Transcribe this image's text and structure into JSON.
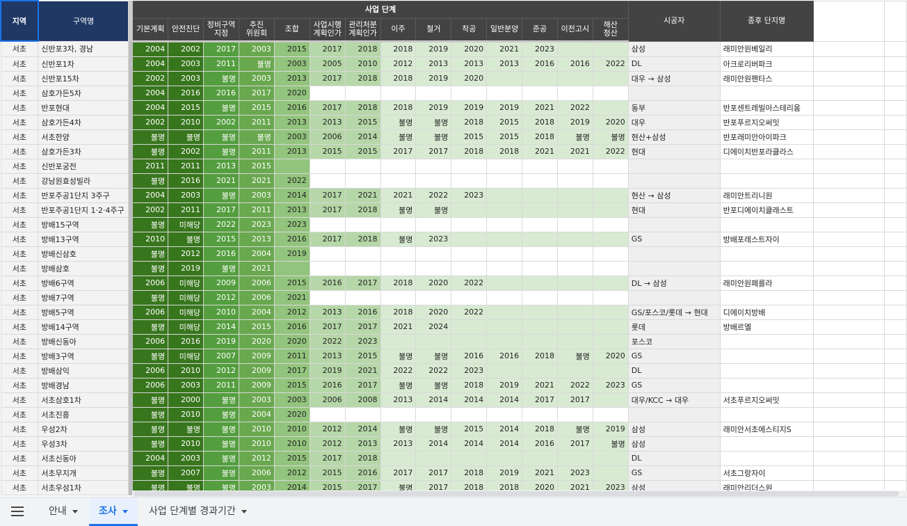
{
  "header": {
    "region": "지역",
    "name": "구역명",
    "group": "사업 단계",
    "stages": [
      "기본계획",
      "안전진단",
      "정비구역\n지정",
      "추진\n위원회",
      "조합",
      "사업시행\n계획인가",
      "관리처분\n계획인가",
      "이주",
      "철거",
      "착공",
      "일반분양",
      "준공",
      "이전고시",
      "해산\n청산"
    ],
    "contractor": "시공자",
    "final_name": "종후 단지명"
  },
  "rows": [
    {
      "region": "서초",
      "name": "신반포3차, 경남",
      "stages": [
        "2004",
        "2002",
        "2017",
        "2003",
        "2015",
        "2017",
        "2018",
        "2018",
        "2019",
        "2020",
        "2021",
        "2023",
        "",
        ""
      ],
      "contractor": "삼성",
      "final": "래미안원베일리"
    },
    {
      "region": "서초",
      "name": "신반포1차",
      "stages": [
        "2004",
        "2003",
        "2011",
        "불명",
        "2003",
        "2005",
        "2010",
        "2012",
        "2013",
        "2013",
        "2013",
        "2016",
        "2016",
        "2022"
      ],
      "contractor": "DL",
      "final": "아크로리버파크"
    },
    {
      "region": "서초",
      "name": "신반포15차",
      "stages": [
        "2002",
        "2003",
        "불명",
        "2003",
        "2013",
        "2017",
        "2018",
        "2018",
        "2019",
        "2020",
        "",
        "",
        "",
        ""
      ],
      "contractor": "대우 → 삼성",
      "final": "래미안원펜타스"
    },
    {
      "region": "서초",
      "name": "삼호가든5차",
      "stages": [
        "2004",
        "2016",
        "2016",
        "2017",
        "2020",
        "",
        "",
        "",
        "",
        "",
        "",
        "",
        "",
        ""
      ],
      "contractor": "",
      "final": ""
    },
    {
      "region": "서초",
      "name": "반포현대",
      "stages": [
        "2004",
        "2015",
        "불명",
        "2015",
        "2016",
        "2017",
        "2018",
        "2018",
        "2019",
        "2019",
        "2019",
        "2021",
        "2022",
        ""
      ],
      "contractor": "동부",
      "final": "반포센트레빌아스테리움"
    },
    {
      "region": "서초",
      "name": "삼호가든4차",
      "stages": [
        "2002",
        "2010",
        "2002",
        "2011",
        "2013",
        "2013",
        "2015",
        "불명",
        "불명",
        "2018",
        "2015",
        "2018",
        "2019",
        "2020"
      ],
      "contractor": "대우",
      "final": "반포푸르지오써밋"
    },
    {
      "region": "서초",
      "name": "서초한양",
      "stages": [
        "불명",
        "불명",
        "불명",
        "불명",
        "2003",
        "2006",
        "2014",
        "불명",
        "불명",
        "2015",
        "2015",
        "2018",
        "불명",
        "불명"
      ],
      "contractor": "현산+삼성",
      "final": "반포래미안아이파크"
    },
    {
      "region": "서초",
      "name": "삼호가든3차",
      "stages": [
        "불명",
        "2002",
        "불명",
        "2011",
        "2013",
        "2015",
        "2015",
        "2017",
        "2017",
        "2018",
        "2018",
        "2021",
        "2021",
        "2022"
      ],
      "contractor": "현대",
      "final": "디에이치반포라클라스"
    },
    {
      "region": "서초",
      "name": "신반포궁전",
      "stages": [
        "2011",
        "2011",
        "2013",
        "2015",
        "",
        "",
        "",
        "",
        "",
        "",
        "",
        "",
        "",
        ""
      ],
      "contractor": "",
      "final": ""
    },
    {
      "region": "서초",
      "name": "강남원효성빌라",
      "stages": [
        "불명",
        "2016",
        "2021",
        "2021",
        "2022",
        "",
        "",
        "",
        "",
        "",
        "",
        "",
        "",
        ""
      ],
      "contractor": "",
      "final": ""
    },
    {
      "region": "서초",
      "name": "반포주공1단지 3주구",
      "stages": [
        "2004",
        "2003",
        "불명",
        "2003",
        "2014",
        "2017",
        "2021",
        "2021",
        "2022",
        "2023",
        "",
        "",
        "",
        ""
      ],
      "contractor": "현산 → 삼성",
      "final": "래미안트리니원"
    },
    {
      "region": "서초",
      "name": "반포주공1단지 1·2·4주구",
      "stages": [
        "2002",
        "2011",
        "2017",
        "2011",
        "2013",
        "2017",
        "2018",
        "불명",
        "불명",
        "",
        "",
        "",
        "",
        ""
      ],
      "contractor": "현대",
      "final": "반포디에이치클래스트"
    },
    {
      "region": "서초",
      "name": "방배15구역",
      "stages": [
        "불명",
        "미해당",
        "2022",
        "2023",
        "2023",
        "",
        "",
        "",
        "",
        "",
        "",
        "",
        "",
        ""
      ],
      "contractor": "",
      "final": ""
    },
    {
      "region": "서초",
      "name": "방배13구역",
      "stages": [
        "2010",
        "불명",
        "2015",
        "2013",
        "2016",
        "2017",
        "2018",
        "불명",
        "2023",
        "",
        "",
        "",
        "",
        ""
      ],
      "contractor": "GS",
      "final": "방배포레스트자이"
    },
    {
      "region": "서초",
      "name": "방배신삼호",
      "stages": [
        "불명",
        "2012",
        "2016",
        "2004",
        "2019",
        "",
        "",
        "",
        "",
        "",
        "",
        "",
        "",
        ""
      ],
      "contractor": "",
      "final": ""
    },
    {
      "region": "서초",
      "name": "방배삼호",
      "stages": [
        "불명",
        "2019",
        "불명",
        "2021",
        "",
        "",
        "",
        "",
        "",
        "",
        "",
        "",
        "",
        ""
      ],
      "contractor": "",
      "final": ""
    },
    {
      "region": "서초",
      "name": "방배6구역",
      "stages": [
        "2006",
        "미해당",
        "2009",
        "2006",
        "2015",
        "2016",
        "2017",
        "2018",
        "2020",
        "2022",
        "",
        "",
        "",
        ""
      ],
      "contractor": "DL → 삼성",
      "final": "래미안원페를라"
    },
    {
      "region": "서초",
      "name": "방배7구역",
      "stages": [
        "불명",
        "미해당",
        "2012",
        "2006",
        "2021",
        "",
        "",
        "",
        "",
        "",
        "",
        "",
        "",
        ""
      ],
      "contractor": "",
      "final": ""
    },
    {
      "region": "서초",
      "name": "방배5구역",
      "stages": [
        "2006",
        "미해당",
        "2010",
        "2004",
        "2012",
        "2013",
        "2016",
        "2018",
        "2020",
        "2022",
        "",
        "",
        "",
        ""
      ],
      "contractor": "GS/포스코/롯데 → 현대",
      "final": "디에이치방배"
    },
    {
      "region": "서초",
      "name": "방배14구역",
      "stages": [
        "불명",
        "미해당",
        "2014",
        "2015",
        "2016",
        "2017",
        "2017",
        "2021",
        "2024",
        "",
        "",
        "",
        "",
        ""
      ],
      "contractor": "롯데",
      "final": "방배르엘"
    },
    {
      "region": "서초",
      "name": "방배신동아",
      "stages": [
        "2006",
        "2016",
        "2019",
        "2020",
        "2020",
        "2022",
        "2023",
        "",
        "",
        "",
        "",
        "",
        "",
        ""
      ],
      "contractor": "포스코",
      "final": ""
    },
    {
      "region": "서초",
      "name": "방배3구역",
      "stages": [
        "불명",
        "미해당",
        "2007",
        "2009",
        "2011",
        "2013",
        "2015",
        "불명",
        "불명",
        "2016",
        "2016",
        "2018",
        "불명",
        "2020"
      ],
      "contractor": "GS",
      "final": ""
    },
    {
      "region": "서초",
      "name": "방배삼익",
      "stages": [
        "2006",
        "2010",
        "2012",
        "2009",
        "2017",
        "2019",
        "2021",
        "2022",
        "2022",
        "2023",
        "",
        "",
        "",
        ""
      ],
      "contractor": "DL",
      "final": ""
    },
    {
      "region": "서초",
      "name": "방배경남",
      "stages": [
        "2006",
        "2003",
        "2011",
        "2009",
        "2015",
        "2016",
        "2017",
        "불명",
        "불명",
        "2018",
        "2019",
        "2021",
        "2022",
        "2023"
      ],
      "contractor": "GS",
      "final": ""
    },
    {
      "region": "서초",
      "name": "서초삼호1차",
      "stages": [
        "불명",
        "2000",
        "불명",
        "2003",
        "2003",
        "2006",
        "2008",
        "2013",
        "2014",
        "2014",
        "2014",
        "2017",
        "2017",
        ""
      ],
      "contractor": "대우/KCC → 대우",
      "final": "서초푸르지오써밋"
    },
    {
      "region": "서초",
      "name": "서초진흥",
      "stages": [
        "불명",
        "2010",
        "불명",
        "2004",
        "2020",
        "",
        "",
        "",
        "",
        "",
        "",
        "",
        "",
        ""
      ],
      "contractor": "",
      "final": ""
    },
    {
      "region": "서초",
      "name": "우성2차",
      "stages": [
        "불명",
        "불명",
        "불명",
        "2010",
        "2010",
        "2012",
        "2014",
        "불명",
        "불명",
        "2015",
        "2014",
        "2018",
        "불명",
        "2019"
      ],
      "contractor": "삼성",
      "final": "래미안서초에스티지S"
    },
    {
      "region": "서초",
      "name": "우성3차",
      "stages": [
        "불명",
        "2010",
        "불명",
        "2010",
        "2010",
        "2012",
        "2013",
        "2013",
        "2014",
        "2014",
        "2014",
        "2016",
        "2017",
        "불명"
      ],
      "contractor": "삼성",
      "final": ""
    },
    {
      "region": "서초",
      "name": "서초신동아",
      "stages": [
        "2004",
        "2003",
        "불명",
        "2012",
        "2015",
        "2017",
        "2018",
        "",
        "",
        "",
        "",
        "",
        "",
        ""
      ],
      "contractor": "DL",
      "final": ""
    },
    {
      "region": "서초",
      "name": "서초무지개",
      "stages": [
        "불명",
        "2007",
        "불명",
        "2006",
        "2012",
        "2015",
        "2016",
        "2017",
        "2017",
        "2018",
        "2019",
        "2021",
        "2023",
        ""
      ],
      "contractor": "GS",
      "final": "서초그랑자이"
    },
    {
      "region": "서초",
      "name": "서초우성1차",
      "stages": [
        "불명",
        "불명",
        "불명",
        "2003",
        "2014",
        "2015",
        "2017",
        "불명",
        "2017",
        "2018",
        "2018",
        "2020",
        "2021",
        "2023"
      ],
      "contractor": "삼성",
      "final": "래미안리더스원"
    }
  ],
  "tabs": {
    "menu_icon": "hamburger-menu-icon",
    "items": [
      {
        "label": "안내",
        "active": false
      },
      {
        "label": "조사",
        "active": true
      },
      {
        "label": "사업 단계별 경과기간",
        "active": false
      }
    ]
  },
  "colors": {
    "header_bg": "#434343",
    "green_shades": [
      "#38761d",
      "#549e3f",
      "#6aa84f",
      "#93c47d",
      "#b6d7a8",
      "#d9ead3"
    ],
    "active_tab": "#1a73e8"
  }
}
